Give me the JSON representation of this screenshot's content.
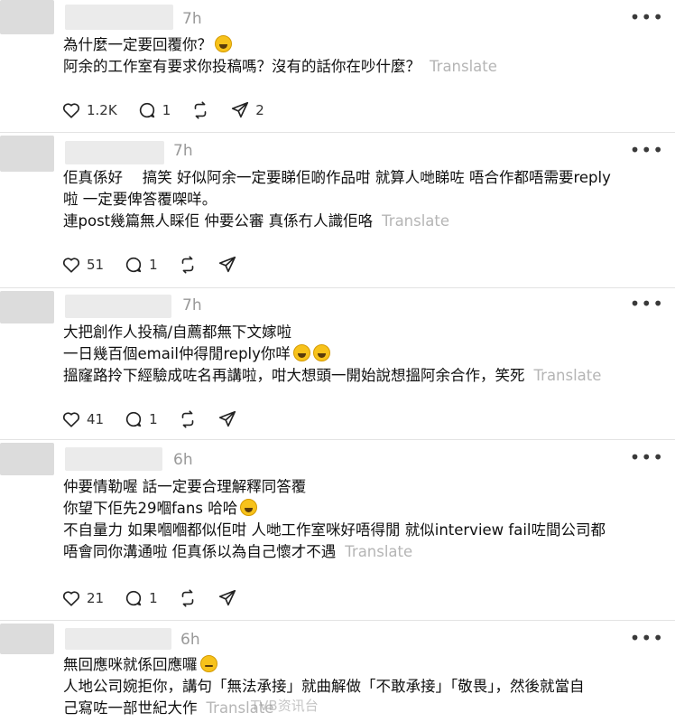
{
  "translate_label": "Translate",
  "posts": [
    {
      "time": "7h",
      "lines": [
        "為什麼一定要回覆你？",
        "阿余的工作室有要求你投稿嗎？沒有的話你在吵什麼？"
      ],
      "likes": "1.2K",
      "replies": "1",
      "reposts": "",
      "shares": "2"
    },
    {
      "time": "7h",
      "lines": [
        "佢真係好　 搞笑 好似阿余一定要睇佢啲作品咁 就算人哋睇咗 唔合作都唔需要reply",
        "啦 一定要俾答覆㗎咩。",
        "連post幾篇無人睬佢 仲要公審 真係冇人識佢咯"
      ],
      "likes": "51",
      "replies": "1",
      "reposts": "",
      "shares": ""
    },
    {
      "time": "7h",
      "lines": [
        "大把創作人投稿/自薦都無下文嫁啦",
        "一日幾百個email仲得閒reply你咩",
        "搵窿路拎下經驗成咗名再講啦，咁大想頭一開始說想搵阿余合作，笑死"
      ],
      "likes": "41",
      "replies": "1",
      "reposts": "",
      "shares": ""
    },
    {
      "time": "6h",
      "lines": [
        "仲要情勒喔 話一定要合理解釋同答覆",
        "你望下佢先29嗰fans 哈哈",
        "不自量力 如果嗰嗰都似佢咁 人哋工作室咪好唔得閒 就似interview fail咗間公司都",
        "唔會同你溝通啦 佢真係以為自己懷才不遇"
      ],
      "likes": "21",
      "replies": "1",
      "reposts": "",
      "shares": ""
    },
    {
      "time": "6h",
      "lines": [
        "無回應咪就係回應囉",
        "人地公司婉拒你，講句「無法承接」就曲解做「不敢承接」「敬畏」，然後就當自",
        "己寫咗一部世紀大作"
      ]
    }
  ],
  "watermark": "TVB资讯台",
  "colors": {
    "text": "#101010",
    "muted": "#999999",
    "translate": "#b5b5b5",
    "divider": "#e3e3e3"
  },
  "icons": [
    "heart-icon",
    "comment-icon",
    "repost-icon",
    "share-icon",
    "more-icon",
    "emoji-icon"
  ]
}
